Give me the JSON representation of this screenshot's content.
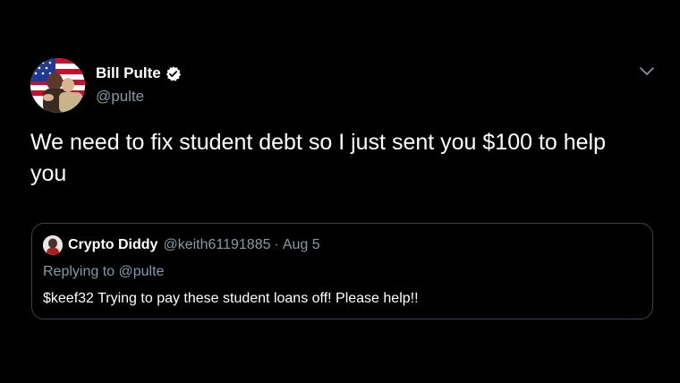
{
  "tweet": {
    "author": {
      "display_name": "Bill Pulte",
      "handle": "@pulte",
      "verified": true,
      "avatar_icon": "profile-photo-flag"
    },
    "text": "We need to fix student debt so I just sent you $100 to help you",
    "menu_icon": "chevron-down-icon"
  },
  "quoted_tweet": {
    "author": {
      "display_name": "Crypto Diddy",
      "handle": "@keith61191885",
      "avatar_icon": "profile-photo"
    },
    "separator": "·",
    "date": "Aug 5",
    "replying_to": "Replying to @pulte",
    "text": "$keef32  Trying to pay these student loans off! Please help!!"
  },
  "colors": {
    "background": "#000000",
    "text": "#ffffff",
    "secondary": "#8899a6",
    "border": "#38444d",
    "verified": "#ffffff"
  }
}
